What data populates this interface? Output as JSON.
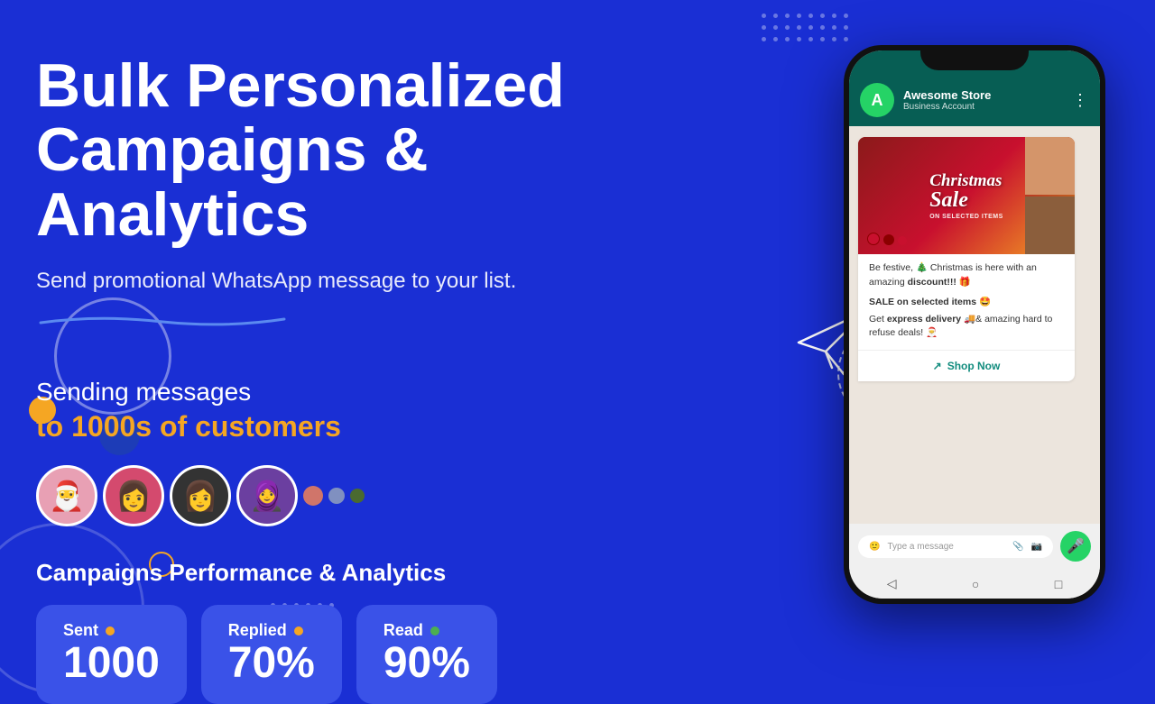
{
  "background": {
    "color": "#1a2fd4"
  },
  "headline": {
    "line1": "Bulk Personalized",
    "line2": "Campaigns & Analytics"
  },
  "subheadline": "Send promotional WhatsApp message to your list.",
  "sending": {
    "line1": "Sending messages",
    "line2": "to 1000s of customers"
  },
  "analytics": {
    "title": "Campaigns Performance & Analytics",
    "stats": [
      {
        "label": "Sent",
        "value": "1000",
        "dot_color": "#f5a623"
      },
      {
        "label": "Replied",
        "value": "70%",
        "dot_color": "#f5a623"
      },
      {
        "label": "Read",
        "value": "90%",
        "dot_color": "#4caf50"
      }
    ]
  },
  "phone": {
    "contact_name": "Awesome Store",
    "contact_status": "Business Account",
    "contact_initial": "A",
    "message": {
      "image_text_line1": "Christmas",
      "image_text_line2": "Sale",
      "image_subtitle": "ON SELECTED ITEMS",
      "text1": "Be festive, 🎄 Christmas is here with an amazing",
      "text1_bold": "discount!!!",
      "text1_end": "🎁",
      "text2": "SALE on selected items 🤩",
      "text3_start": "Get",
      "text3_bold": "express delivery",
      "text3_end": "🚚& amazing hard to refuse deals! 🎅",
      "shop_now": "Shop Now"
    },
    "input_placeholder": "Type a message"
  },
  "avatars": [
    {
      "emoji": "🎅",
      "bg": "#e8a0b4"
    },
    {
      "emoji": "👩",
      "bg": "#d44a6e"
    },
    {
      "emoji": "👩",
      "bg": "#2c2c2c"
    },
    {
      "emoji": "🧕",
      "bg": "#6b3fa0"
    }
  ],
  "extra_dots": [
    {
      "color": "#d0756a",
      "size": 22
    },
    {
      "color": "#8090c0",
      "size": 18
    },
    {
      "color": "#4a6a30",
      "size": 16
    }
  ]
}
